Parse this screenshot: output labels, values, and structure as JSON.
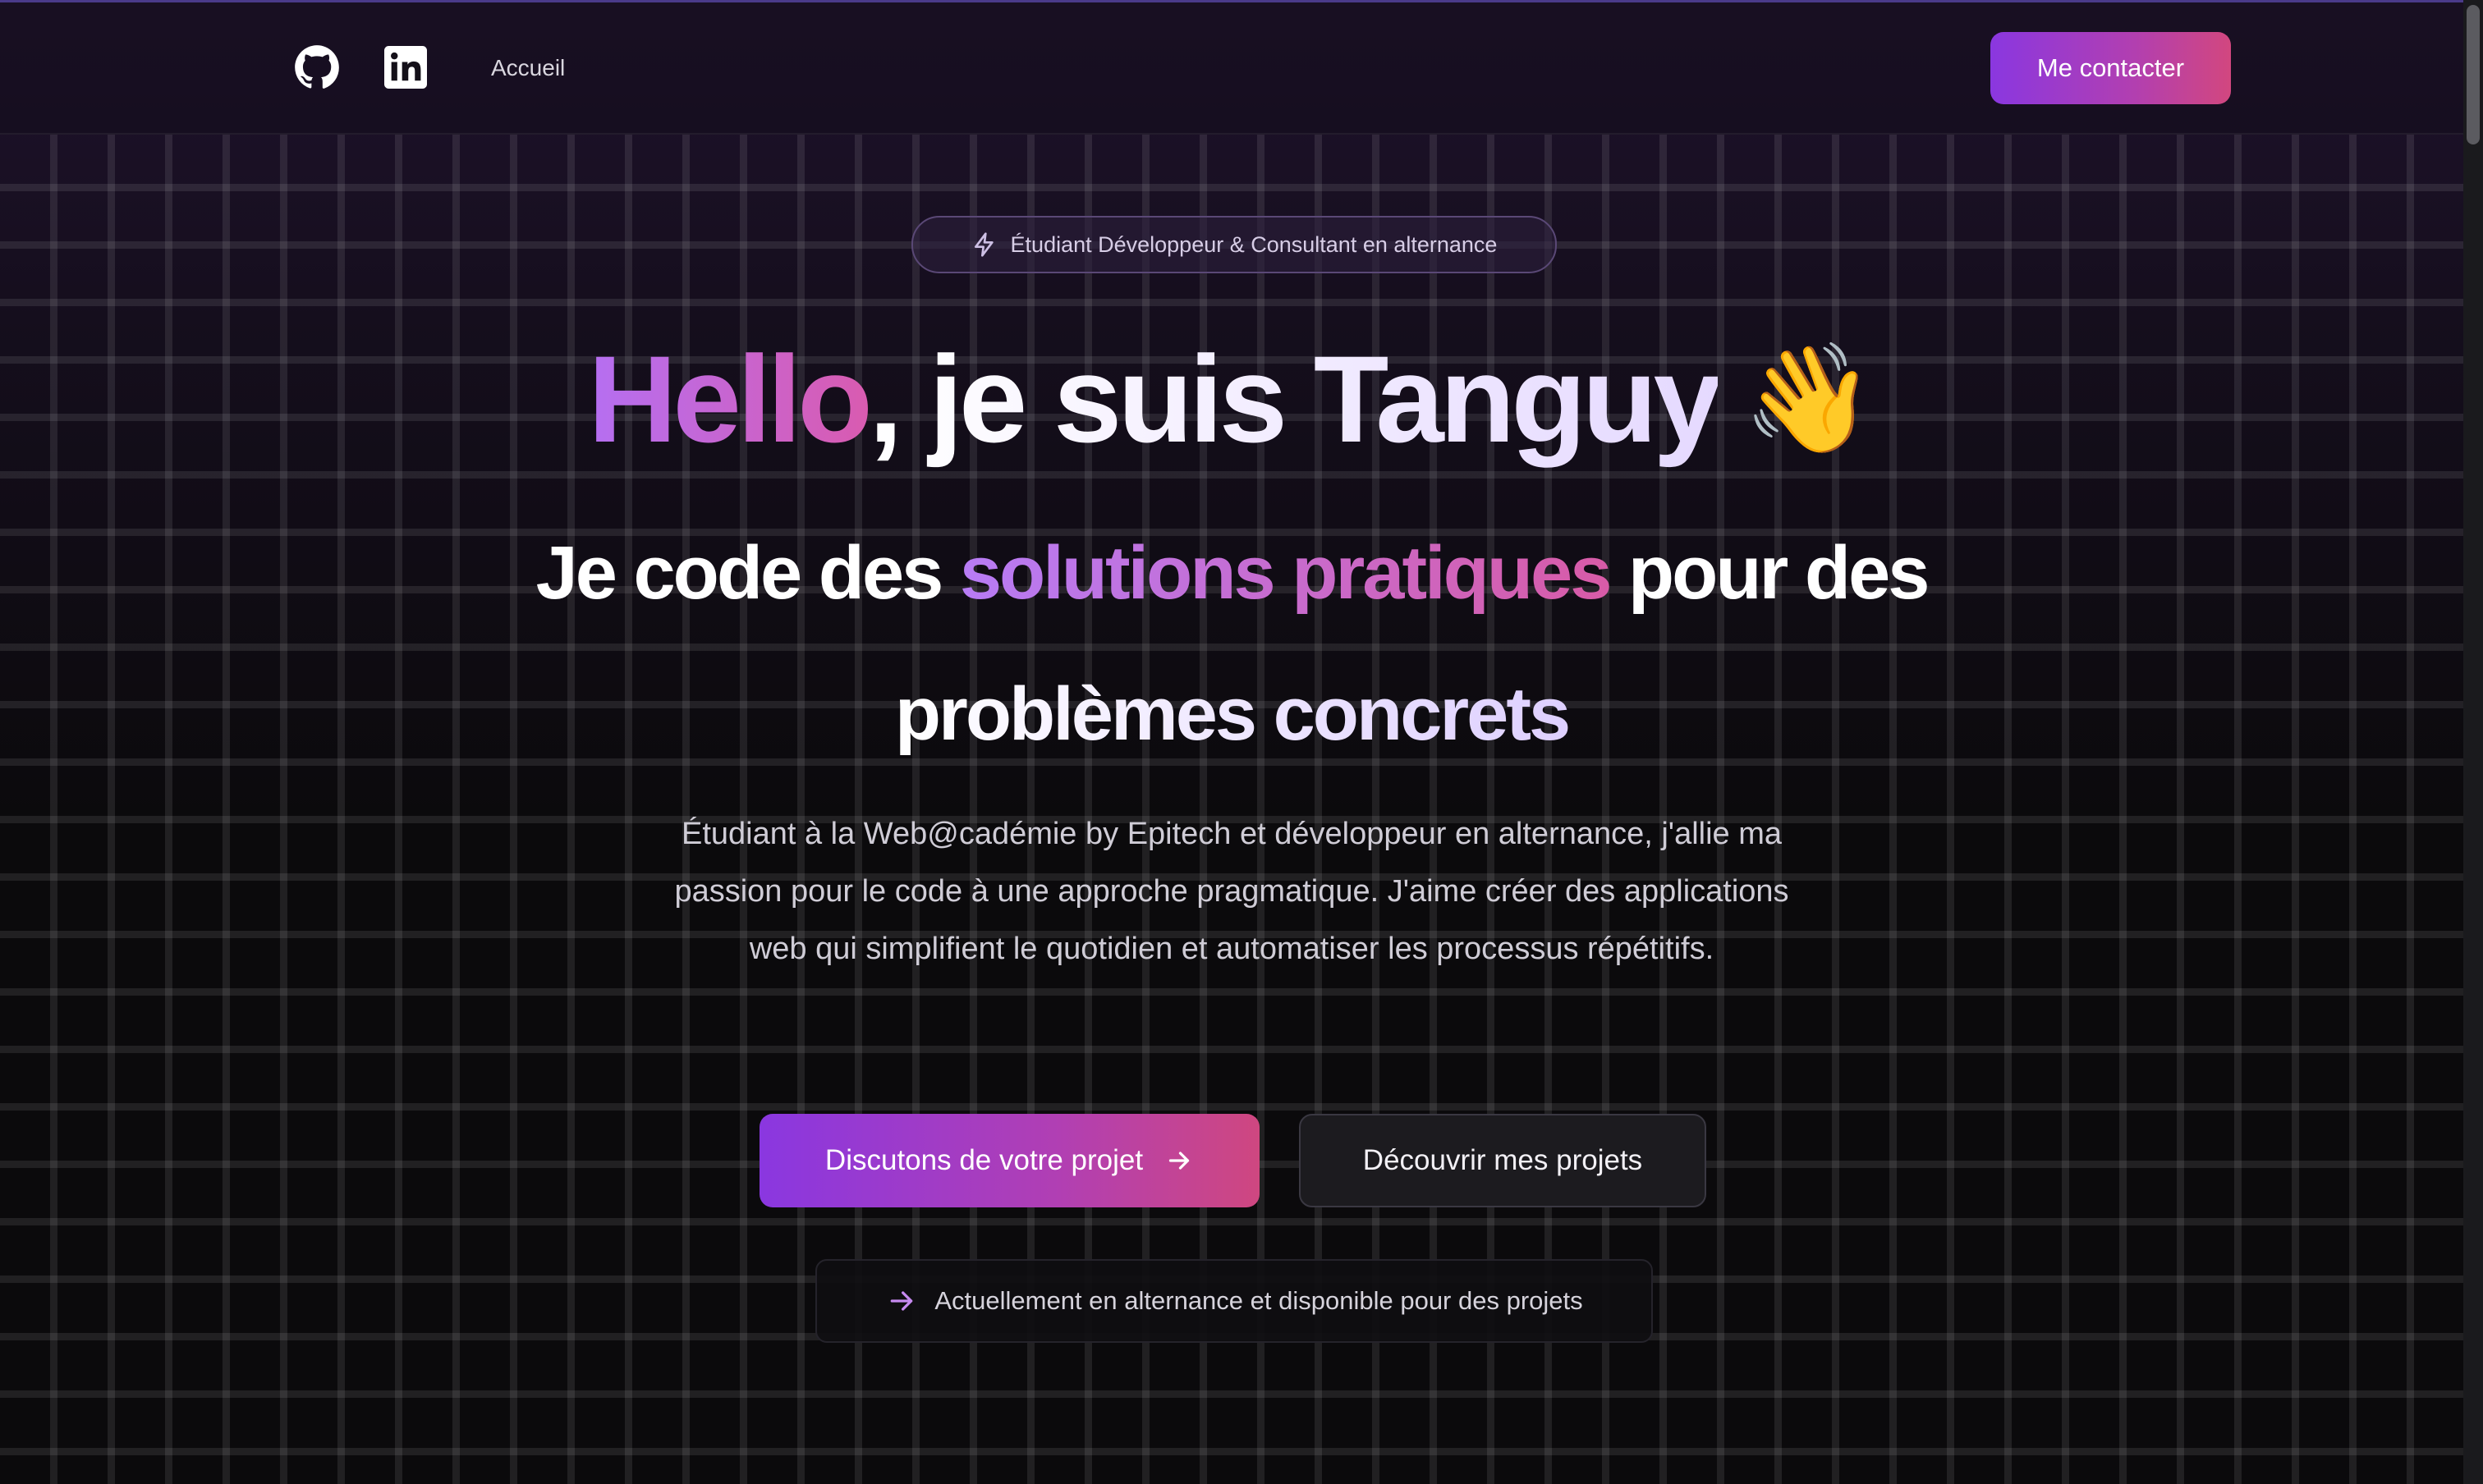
{
  "header": {
    "nav_link": "Accueil",
    "contact_label": "Me contacter",
    "icons": [
      "github-icon",
      "linkedin-icon"
    ]
  },
  "hero": {
    "badge": "Étudiant Développeur & Consultant en alternance",
    "title_hello": "Hello",
    "title_rest": ", je suis Tanguy",
    "wave_emoji": "👋",
    "subtitle_part1": "Je code des ",
    "subtitle_highlight": "solutions pratiques",
    "subtitle_part2": " pour des",
    "subtitle_line2": "problèmes concrets",
    "description": "Étudiant à la Web@cadémie by Epitech et développeur en alternance, j'allie ma passion pour le code à une approche pragmatique. J'aime créer des applications web qui simplifient le quotidien et automatiser les processus répétitifs.",
    "primary_button": "Discutons de votre projet",
    "secondary_button": "Découvrir mes projets",
    "status": "Actuellement en alternance et disponible pour des projets"
  },
  "colors": {
    "accent_start": "#8a37e0",
    "accent_end": "#d2477f",
    "background": "#0b0a0c"
  }
}
